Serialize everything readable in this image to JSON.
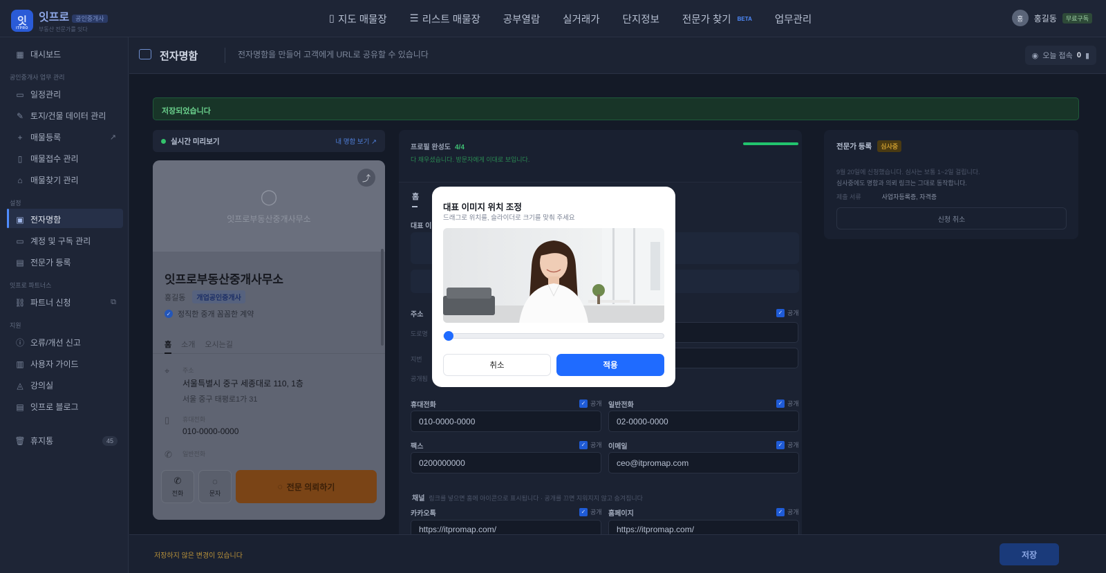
{
  "app": {
    "logo_initial": "잇",
    "logo_sub": "ITPRO",
    "name": "잇프로",
    "tag": "공인중개사",
    "slogan": "부동산 전문가를 잇다"
  },
  "nav": {
    "items": [
      {
        "label": "지도 매물장",
        "icon": "map-icon"
      },
      {
        "label": "리스트 매물장",
        "icon": "list-icon"
      },
      {
        "label": "공부열람"
      },
      {
        "label": "실거래가"
      },
      {
        "label": "단지정보"
      },
      {
        "label": "전문가 찾기",
        "badge": "BETA"
      },
      {
        "label": "업무관리"
      }
    ]
  },
  "user": {
    "avatar": "홍",
    "name": "홍길동",
    "plan": "무료구독"
  },
  "sidebar": {
    "dashboard": "대시보드",
    "section_work": "공인중개사 업무 관리",
    "schedule": "일정관리",
    "land_data": "토지/건물 데이터 관리",
    "listing_add": "매물등록",
    "listing_intake": "매물접수 관리",
    "listing_find": "매물찾기 관리",
    "section_settings": "설정",
    "ecard": "전자명함",
    "account": "계정 및 구독 관리",
    "expert_reg": "전문가 등록",
    "section_partners": "잇프로 파트너스",
    "partner_apply": "파트너 신청",
    "section_help": "지원",
    "bug_report": "오류/개선 신고",
    "guide": "사용자 가이드",
    "lecture": "강의실",
    "blog": "잇프로 블로그",
    "trash": "휴지통",
    "trash_count": "45"
  },
  "page": {
    "title": "전자명함",
    "description": "전자명함을 만들어 고객에게 URL로 공유할 수 있습니다",
    "today_label": "오늘 접속",
    "today_count": "0"
  },
  "toast": "저장되었습니다",
  "preview": {
    "head": "실시간 미리보기",
    "link": "내 명함 보기 ↗",
    "company_placeholder": "잇프로부동산중개사무소",
    "business_name": "잇프로부동산중개사무소",
    "owner": "홍길동",
    "owner_badge": "개업공인중개사",
    "motto": "정직한 중개 꼼꼼한 계약",
    "tabs": [
      "홈",
      "소개",
      "오시는길"
    ],
    "address_label": "주소",
    "address_road": "서울특별시 중구 세종대로 110, 1층",
    "address_lot": "서울 중구 태평로1가 31",
    "mobile_label": "휴대전화",
    "mobile_value": "010-0000-0000",
    "phone_label": "일반전화",
    "call_label": "전화",
    "sms_label": "문자",
    "consult_label": "전문 의뢰하기"
  },
  "form": {
    "completion_label": "프로필 완성도",
    "completion_value": "4/4",
    "completion_fraction": 1.0,
    "completion_desc": "다 채우셨습니다. 방문자에게 이대로 보입니다.",
    "tab_home": "홈",
    "rep_image_label": "대표 이",
    "address_label": "주소",
    "road_faint": "도로명",
    "lot_faint": "지번",
    "public_faint": "공개됨",
    "public": "공개",
    "mobile_label": "휴대전화",
    "mobile_value": "010-0000-0000",
    "phone_label": "일반전화",
    "phone_value": "02-0000-0000",
    "fax_label": "팩스",
    "fax_value": "0200000000",
    "email_label": "이메일",
    "email_value": "ceo@itpromap.com",
    "channel_label": "채널",
    "channel_desc": "링크를 넣으면 홈에 아이콘으로 표시됩니다 · 공개를 끄면 지워지지 않고 숨겨집니다",
    "kakao_label": "카카오톡",
    "kakao_value": "https://itpromap.com/",
    "homepage_label": "홈페이지",
    "homepage_value": "https://itpromap.com/"
  },
  "expert": {
    "title": "전문가 등록",
    "status": "심사중",
    "desc1": "9월 20일에 신청했습니다. 심사는 보통 1~2일 걸립니다.",
    "desc2": "심사중에도 명함과 의뢰 링크는 그대로 동작합니다.",
    "docs_label": "제출 서류",
    "docs_value": "사업자등록증, 자격증",
    "cancel": "신청 취소"
  },
  "bottom": {
    "unsaved": "저장하지 않은 변경이 있습니다",
    "save": "저장"
  },
  "modal": {
    "title": "대표 이미지 위치 조정",
    "subtitle": "드래그로 위치를, 슬라이더로 크기를 맞춰 주세요",
    "zoom_fraction": 0.0,
    "cancel": "취소",
    "apply": "적용"
  }
}
